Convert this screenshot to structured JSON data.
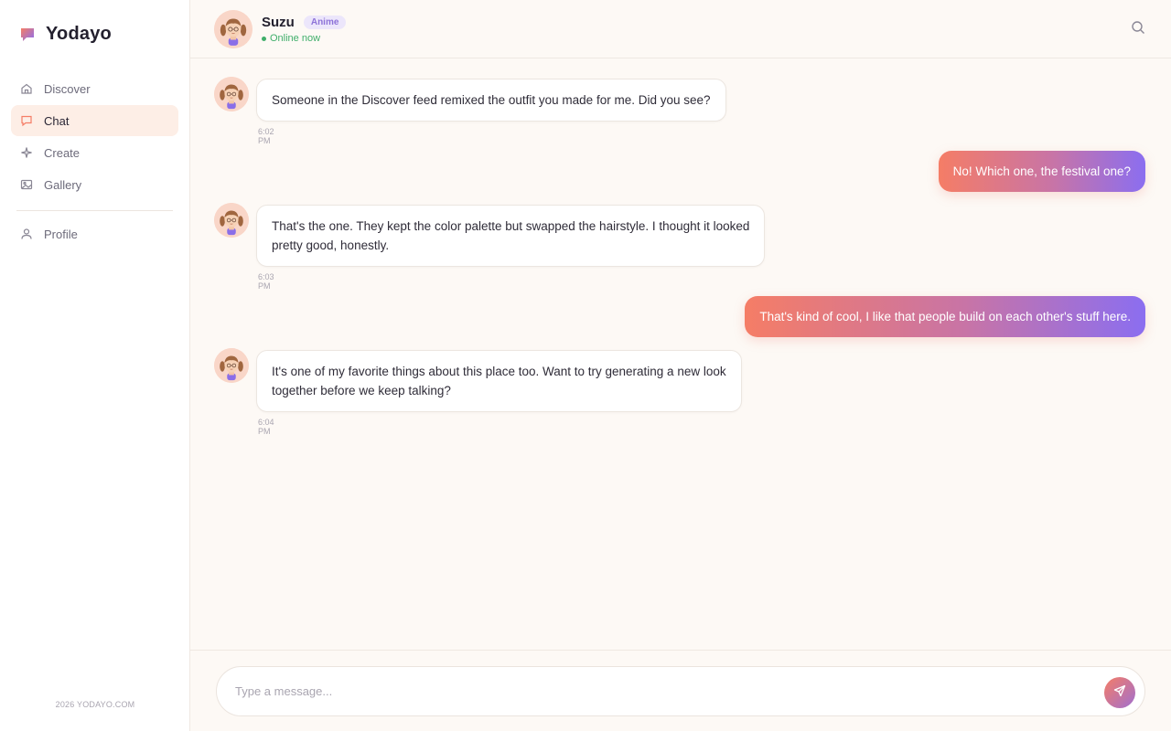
{
  "brand": {
    "name": "Yodayo",
    "accent": "#f57d66",
    "accent2": "#8b6ef0"
  },
  "sidebar": {
    "items": [
      {
        "label": "Discover",
        "icon": "home-icon",
        "active": false
      },
      {
        "label": "Chat",
        "icon": "chat-icon",
        "active": true
      },
      {
        "label": "Create",
        "icon": "sparkle-icon",
        "active": false
      },
      {
        "label": "Gallery",
        "icon": "image-icon",
        "active": false
      }
    ],
    "secondary": [
      {
        "label": "Profile",
        "icon": "user-icon"
      }
    ],
    "footer": "2026 YODAYO.COM"
  },
  "header": {
    "name": "Suzu",
    "badge": "Anime",
    "status": "Online now",
    "status_color": "#3fae6a"
  },
  "messages": [
    {
      "from": "character",
      "text": "Someone in the Discover feed remixed the outfit you made for me. Did you see?",
      "time": "6:02 PM"
    },
    {
      "from": "user",
      "text": "No! Which one, the festival one?"
    },
    {
      "from": "character",
      "text_lines": [
        "That's the one. They kept the color palette but swapped the hairstyle. I thought it looked",
        "pretty good, honestly."
      ],
      "time": "6:03 PM"
    },
    {
      "from": "user",
      "text": "That's kind of cool, I like that people build on each other's stuff here."
    },
    {
      "from": "character",
      "text_lines": [
        "It's one of my favorite things about this place too. Want to try generating a new look",
        "together before we keep talking?"
      ],
      "time": "6:04 PM"
    }
  ],
  "composer": {
    "placeholder": "Type a message...",
    "value": ""
  }
}
